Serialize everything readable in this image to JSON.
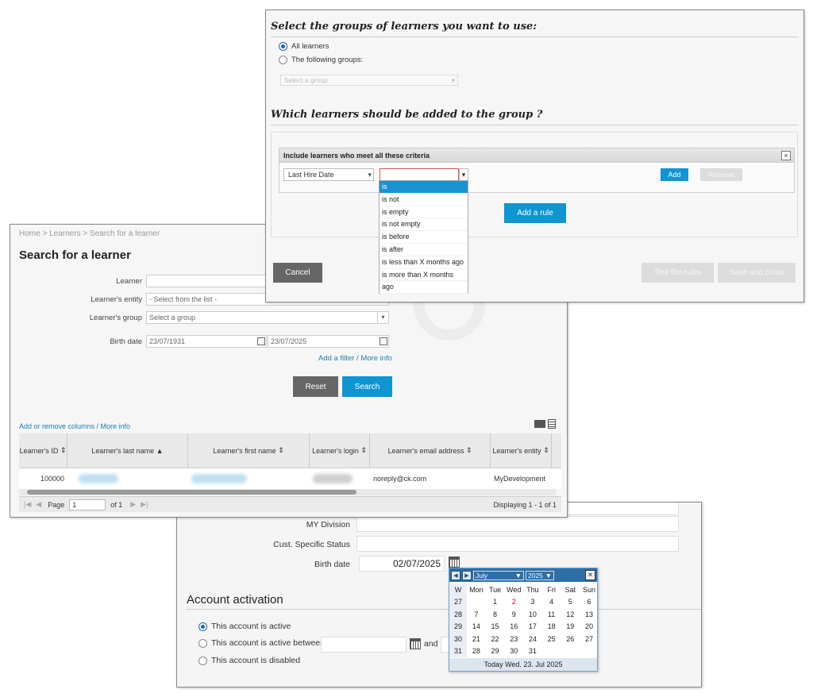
{
  "groups_panel": {
    "heading_groups": "Select the groups of learners you want to use:",
    "radio_all": "All learners",
    "radio_following": "The following groups:",
    "select_group_placeholder": "Select a group",
    "heading_which": "Which learners should be added to the group ?",
    "criteria_title": "Include learners who meet all these criteria",
    "criteria_close": "×",
    "field_select": "Last Hire Date",
    "operator_value": "",
    "operator_options": [
      "is",
      "is not",
      "is empty",
      "is not empty",
      "is before",
      "is after",
      "is less than X months ago",
      "is more than X months",
      "ago"
    ],
    "add_button": "Add",
    "remove_button": "Remove",
    "add_rule_button": "Add a rule",
    "cancel_button": "Cancel",
    "test_rules_button": "Test the rules",
    "save_close_button": "Save and close"
  },
  "search_panel": {
    "breadcrumb": "Home > Learners > Search for a learner",
    "title": "Search for a learner",
    "label_learner": "Learner",
    "label_entity": "Learner's entity",
    "entity_placeholder": "- Select from the list -",
    "label_group": "Learner's group",
    "group_placeholder": "Select a group",
    "label_birth": "Birth date",
    "birth_from": "23/07/1931",
    "birth_to": "23/07/2025",
    "add_filter_link": "Add a filter / More info",
    "reset_button": "Reset",
    "search_button": "Search",
    "columns_link": "Add or remove columns / More info",
    "table": {
      "headers": [
        "Learner's ID",
        "Learner's last name",
        "Learner's first name",
        "Learner's login",
        "Learner's email address",
        "Learner's entity"
      ],
      "sort_marks": [
        "⇕",
        "▲",
        "⇕",
        "⇕",
        "⇕",
        "⇕"
      ],
      "row": {
        "id": "100000",
        "email": "noreply@ck.com",
        "entity": "MyDevelopment"
      }
    },
    "pager": {
      "page_label": "Page",
      "page_value": "1",
      "of_label": "of 1",
      "displaying": "Displaying 1 - 1 of 1"
    }
  },
  "account_panel": {
    "label_division": "MY Division",
    "label_status": "Cust. Specific Status",
    "label_birth": "Birth date",
    "birth_value": "02/07/2025",
    "heading": "Account activation",
    "radio_active": "This account is active",
    "radio_between": "This account is active between",
    "and_label": "and",
    "radio_disabled": "This account is disabled"
  },
  "calendar": {
    "month": "July",
    "year": "2025",
    "close": "×",
    "week_header": "W",
    "day_headers": [
      "Mon",
      "Tue",
      "Wed",
      "Thu",
      "Fri",
      "Sat",
      "Sun"
    ],
    "weeks": [
      {
        "w": "27",
        "days": [
          "",
          "1",
          "2",
          "3",
          "4",
          "5",
          "6"
        ]
      },
      {
        "w": "28",
        "days": [
          "7",
          "8",
          "9",
          "10",
          "11",
          "12",
          "13"
        ]
      },
      {
        "w": "29",
        "days": [
          "14",
          "15",
          "16",
          "17",
          "18",
          "19",
          "20"
        ]
      },
      {
        "w": "30",
        "days": [
          "21",
          "22",
          "23",
          "24",
          "25",
          "26",
          "27"
        ]
      },
      {
        "w": "31",
        "days": [
          "28",
          "29",
          "30",
          "31",
          "",
          "",
          ""
        ]
      }
    ],
    "highlight_day": "2",
    "highlight_color": "#d0021b",
    "footer": "Today Wed. 23. Jul 2025"
  },
  "colors": {
    "accent": "#0f95d0",
    "dark_button": "#666666",
    "calendar_header": "#2e6fa8"
  }
}
